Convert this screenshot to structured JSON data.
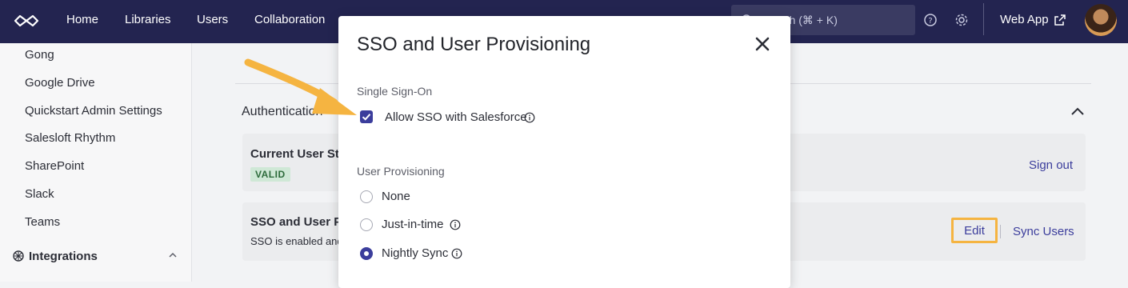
{
  "nav": {
    "links": [
      "Home",
      "Libraries",
      "Users",
      "Collaboration"
    ],
    "search_placeholder": "Search (⌘ + K)",
    "web_app": "Web App"
  },
  "sidebar": {
    "items": [
      "Gong",
      "Google Drive",
      "Quickstart Admin Settings",
      "Salesloft Rhythm",
      "SharePoint",
      "Slack",
      "Teams"
    ],
    "section": "Integrations"
  },
  "main": {
    "auth_title": "Authentication",
    "card1": {
      "title": "Current User Sta",
      "badge": "VALID",
      "action": "Sign out"
    },
    "card2": {
      "title": "SSO and User Pro",
      "subtitle": "SSO is enabled and",
      "edit": "Edit",
      "sync": "Sync Users"
    }
  },
  "modal": {
    "title": "SSO and User Provisioning",
    "sso_label": "Single Sign-On",
    "sso_option": "Allow SSO with Salesforce",
    "sso_checked": true,
    "provisioning_label": "User Provisioning",
    "options": [
      {
        "label": "None",
        "selected": false
      },
      {
        "label": "Just-in-time",
        "selected": false
      },
      {
        "label": "Nightly Sync",
        "selected": true
      }
    ]
  },
  "colors": {
    "nav_bg": "#232450",
    "accent": "#3b3d9c",
    "highlight": "#f5b441"
  }
}
